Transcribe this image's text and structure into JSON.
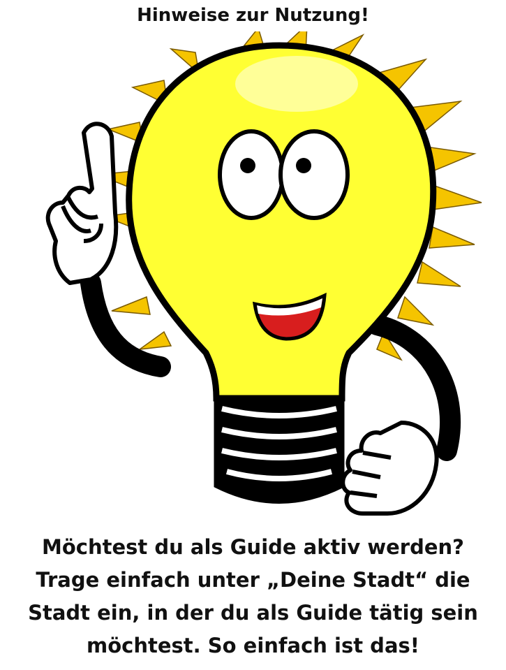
{
  "title": "Hinweise zur Nutzung!",
  "message": {
    "lines": [
      "Möchtest du als Guide aktiv werden?",
      "Trage einfach unter „Deine Stadt“ die",
      "Stadt ein, in der du als Guide tätig sein",
      "möchtest. So einfach ist das!"
    ]
  },
  "illustration": {
    "icon": "lightbulb-mascot-icon",
    "bulb_color": "#ffff33",
    "ray_color": "#f5c400"
  }
}
